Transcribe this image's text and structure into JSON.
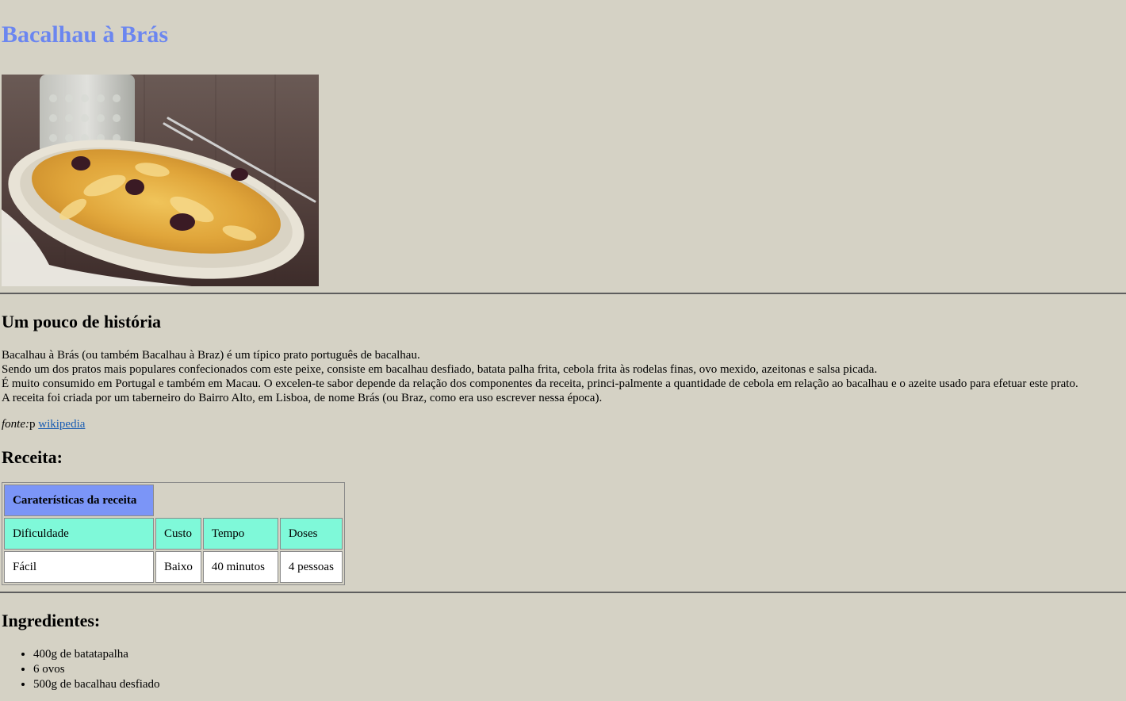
{
  "title": "Bacalhau à Brás",
  "photo": {
    "alt": "Bacalhau à Brás dish on a white plate with olives, fork and glass"
  },
  "historia": {
    "heading": "Um pouco de história",
    "paragraphs": [
      "Bacalhau à Brás (ou também Bacalhau à Braz) é um típico prato português de bacalhau.",
      "Sendo um dos pratos mais populares confecionados com este peixe, consiste em bacalhau desfiado, batata palha frita, cebola frita às rodelas finas, ovo mexido, azeitonas e salsa picada.",
      "É muito consumido em Portugal e também em Macau. O excelen-te sabor depende da relação dos componentes da receita, princi-palmente a quantidade de cebola em relação ao bacalhau e o azeite usado para efetuar este prato.",
      "A receita foi criada por um taberneiro do Bairro Alto, em Lisboa, de nome Brás (ou Braz, como era uso escrever nessa época)."
    ],
    "fonte_label": "fonte:",
    "fonte_extra": "p ",
    "fonte_link": "wikipedia"
  },
  "receita": {
    "heading": "Receita:",
    "table_header": "Caraterísticas da receita",
    "columns": [
      "Dificuldade",
      "Custo",
      "Tempo",
      "Doses"
    ],
    "values": [
      "Fácil",
      "Baixo",
      "40 minutos",
      "4 pessoas"
    ]
  },
  "ingredientes": {
    "heading": "Ingredientes:",
    "items": [
      "400g de batatapalha",
      "6 ovos",
      "500g de bacalhau desfiado"
    ]
  },
  "colors": {
    "background": "#d5d2c5",
    "title": "#6b86f0",
    "table_header": "#7b95f7",
    "table_category": "#7ff9d9"
  }
}
